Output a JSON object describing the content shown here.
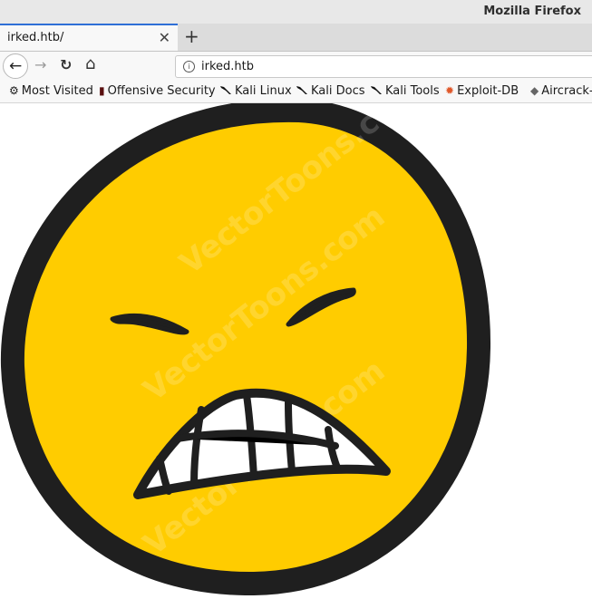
{
  "window": {
    "title": "Mozilla Firefox"
  },
  "tab": {
    "title": "irked.htb/",
    "close_glyph": "✕",
    "new_tab_glyph": "+"
  },
  "toolbar": {
    "back_icon": "←",
    "forward_icon": "→",
    "reload_icon": "↻",
    "home_icon": "⌂",
    "url": "irked.htb",
    "info_glyph": "i"
  },
  "bookmarks": [
    {
      "label": "Most Visited",
      "icon": "gear-icon",
      "glyph": "⚙"
    },
    {
      "label": "Offensive Security",
      "icon": "offsec-icon",
      "glyph": "▮"
    },
    {
      "label": "Kali Linux",
      "icon": "kali-dragon-icon"
    },
    {
      "label": "Kali Docs",
      "icon": "kali-dragon-icon"
    },
    {
      "label": "Kali Tools",
      "icon": "kali-dragon-icon"
    },
    {
      "label": "Exploit-DB",
      "icon": "exploitdb-icon",
      "glyph": "✹"
    },
    {
      "label": "Aircrack-",
      "icon": "aircrack-icon",
      "glyph": "◆"
    }
  ],
  "page": {
    "watermark": "VectorToons.com"
  },
  "colors": {
    "face_fill": "#ffcc00",
    "outline": "#1f1f1f",
    "tab_accent": "#2f6fd6"
  }
}
